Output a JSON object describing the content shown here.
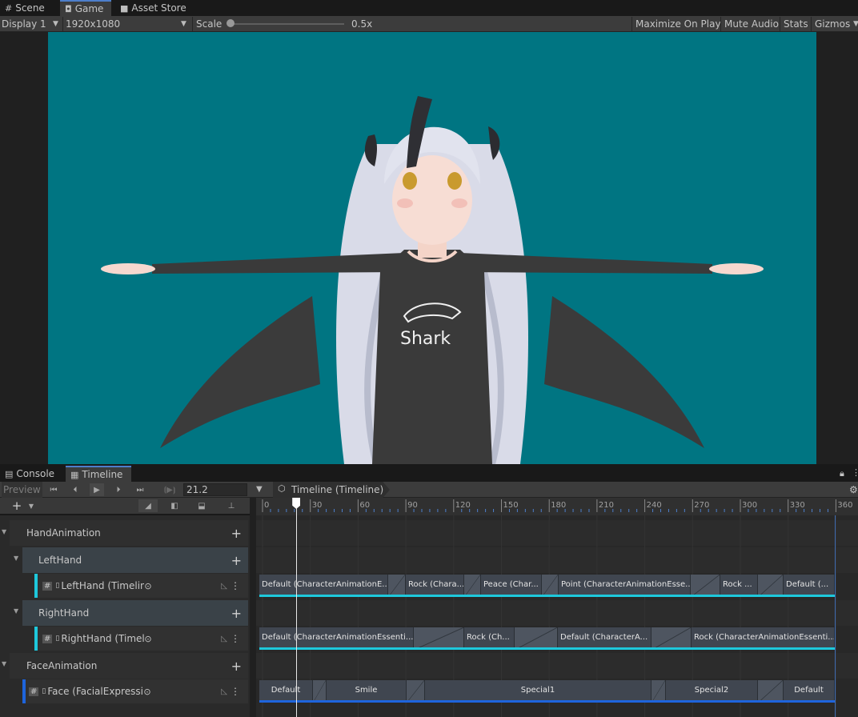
{
  "tabs": [
    {
      "label": "Scene",
      "icon": "grid-icon"
    },
    {
      "label": "Game",
      "icon": "gamepad-icon"
    },
    {
      "label": "Asset Store",
      "icon": "store-bag-icon"
    }
  ],
  "game_toolbar": {
    "display": "Display 1",
    "resolution": "1920x1080",
    "scale_label": "Scale",
    "scale_value": "0.5x",
    "scale_level": 0.0,
    "maximize": "Maximize On Play",
    "mute": "Mute Audio",
    "stats": "Stats",
    "gizmos": "Gizmos"
  },
  "viewport": {
    "bg_color": "#007582",
    "shirt_text": "Shark"
  },
  "lower_tabs": [
    {
      "label": "Console",
      "icon": "console-icon"
    },
    {
      "label": "Timeline",
      "icon": "film-icon"
    }
  ],
  "timeline": {
    "preview": "Preview",
    "frame": "21.2",
    "asset_name": "Timeline (Timeline)",
    "ruler_ticks": [
      "0",
      "30",
      "60",
      "90",
      "120",
      "150",
      "180",
      "210",
      "240",
      "270",
      "300",
      "330",
      "360"
    ],
    "playhead_frame": 21.2,
    "groups": [
      {
        "label": "HandAnimation"
      },
      {
        "label": "LeftHand",
        "track": "LeftHand (Timeline"
      },
      {
        "label": "RightHand",
        "track": "RightHand (Timelin"
      },
      {
        "label": "FaceAnimation",
        "track": "Face (FacialExpressio"
      }
    ],
    "lefthand_clips": [
      "Default (CharacterAnimationE...",
      "Rock (Chara...",
      "Peace (Char...",
      "Point (CharacterAnimationEsse...",
      "Rock ...",
      "Default (..."
    ],
    "righthand_clips": [
      "Default (CharacterAnimationEssenti...",
      "Rock (Ch...",
      "Default (CharacterA...",
      "Rock (CharacterAnimationEssenti..."
    ],
    "face_clips": [
      "Default",
      "Smile",
      "Special1",
      "Special2",
      "Default"
    ],
    "colors": {
      "hand_accent": "#1ec8dc",
      "face_accent": "#1e64dc"
    }
  }
}
